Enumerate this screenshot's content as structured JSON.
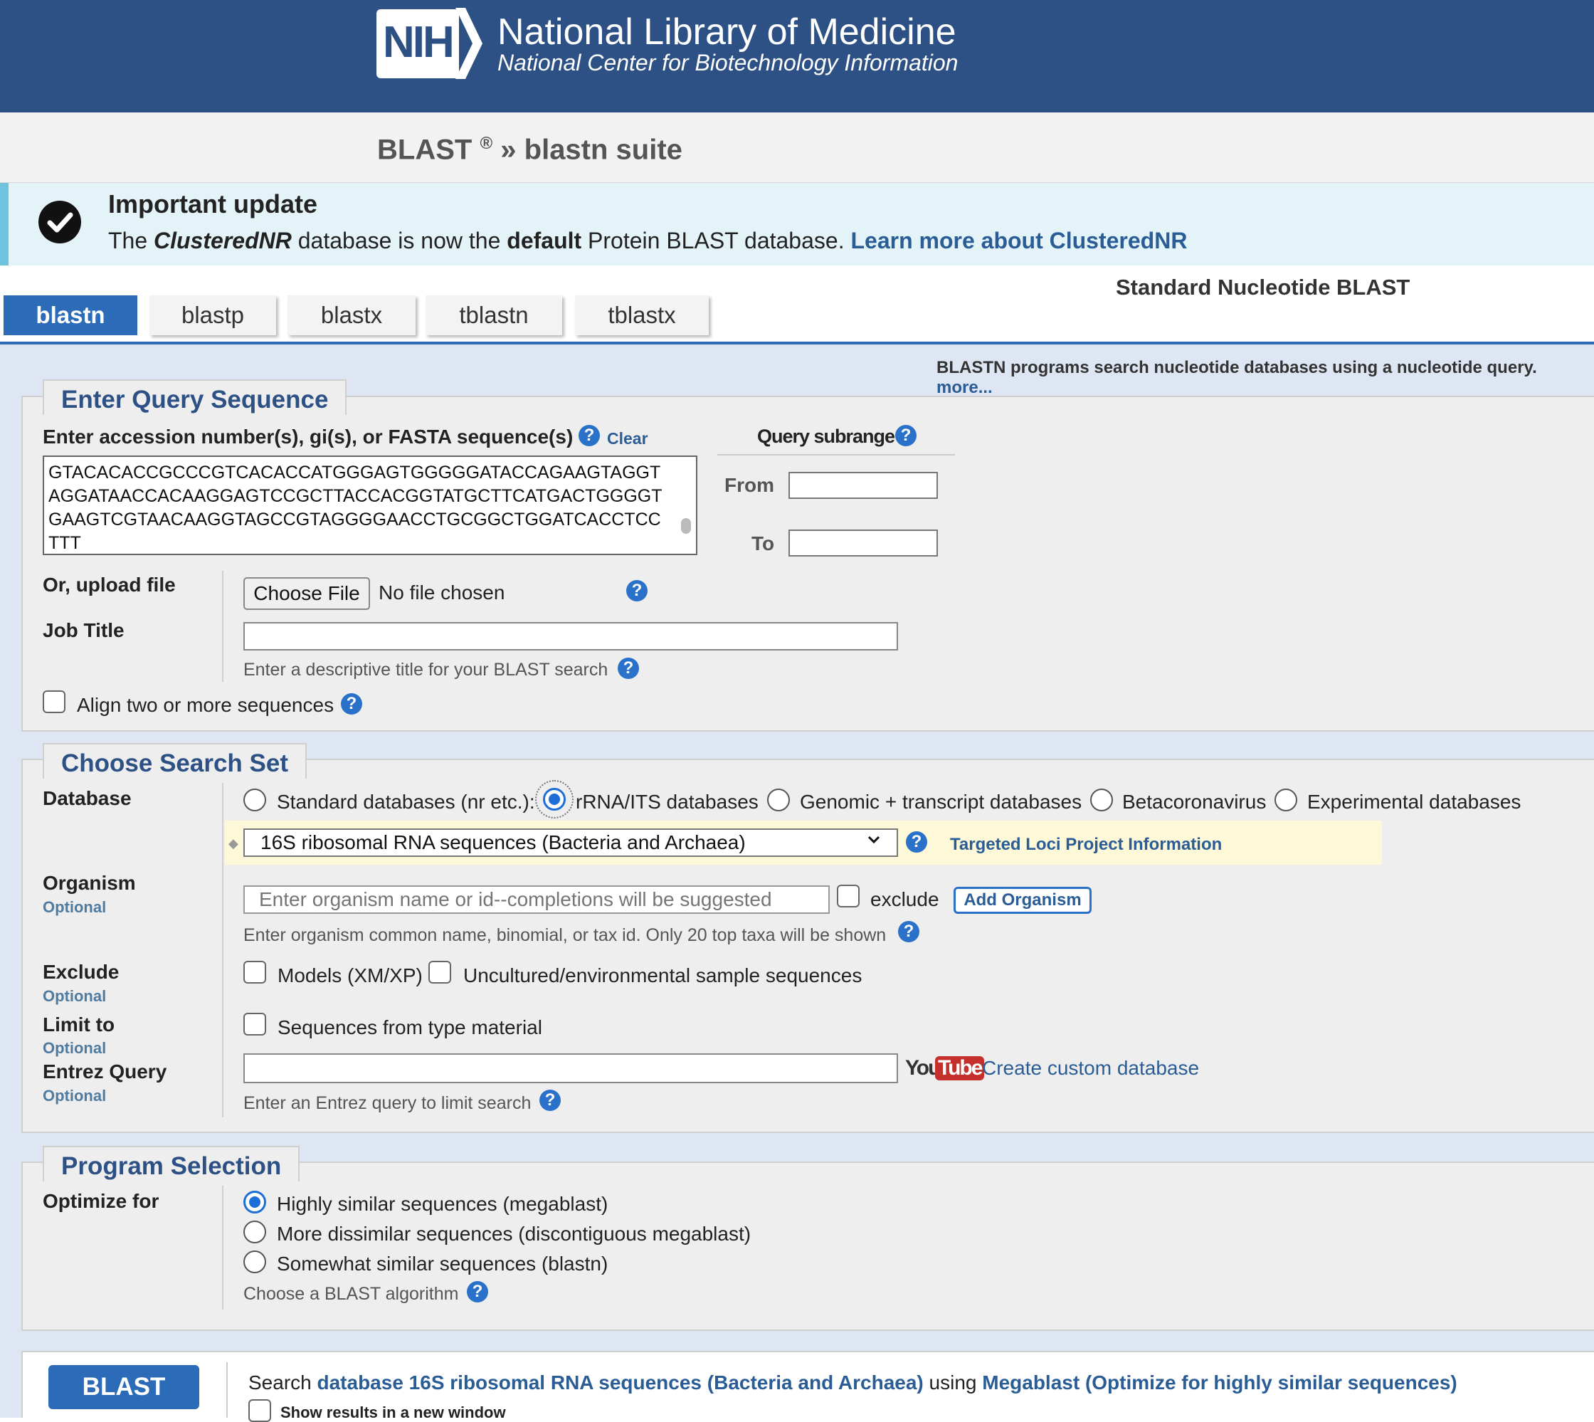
{
  "header": {
    "logo_text": "NIH",
    "title": "National Library of Medicine",
    "subtitle": "National Center for Biotechnology Information"
  },
  "breadcrumb": {
    "blast": "BLAST",
    "reg": "®",
    "sep": "»",
    "suite": "blastn suite"
  },
  "banner": {
    "title": "Important update",
    "text_1": "The ",
    "text_em": "ClusteredNR",
    "text_2": " database is now the ",
    "text_strong": "default",
    "text_3": " Protein BLAST database. ",
    "link": "Learn more about ClusteredNR"
  },
  "tabs": {
    "heading": "Standard Nucleotide BLAST",
    "items": [
      "blastn",
      "blastp",
      "blastx",
      "tblastn",
      "tblastx"
    ],
    "active": "blastn"
  },
  "program_desc": {
    "text": "BLASTN programs search nucleotide databases using a nucleotide query.",
    "more": "more..."
  },
  "query": {
    "legend": "Enter Query Sequence",
    "label": "Enter accession number(s), gi(s), or FASTA sequence(s)",
    "clear": "Clear",
    "sequence_lines": [
      "GTACACACCGCCCGTCACACCATGGGAGTGGGGGATACCAGAAGTAGGT",
      "AGGATAACCACAAGGAGTCCGCTTACCACGGTATGCTTCATGACTGGGGT",
      "GAAGTCGTAACAAGGTAGCCGTAGGGGAACCTGCGGCTGGATCACCTCC",
      "TTT"
    ],
    "subrange_label": "Query subrange",
    "from_label": "From",
    "to_label": "To",
    "from_value": "",
    "to_value": "",
    "upload_label": "Or, upload file",
    "choose_file": "Choose File",
    "no_file": "No file chosen",
    "job_title_label": "Job Title",
    "job_title_value": "",
    "job_title_hint": "Enter a descriptive title for your BLAST search",
    "align_label": "Align two or more sequences"
  },
  "search_set": {
    "legend": "Choose Search Set",
    "database_label": "Database",
    "db_options": [
      "Standard databases (nr etc.):",
      "rRNA/ITS databases",
      "Genomic + transcript databases",
      "Betacoronavirus",
      "Experimental databases"
    ],
    "db_selected": "rRNA/ITS databases",
    "db_select_value": "16S ribosomal RNA sequences (Bacteria and Archaea)",
    "targeted_loci_link": "Targeted Loci Project Information",
    "organism_label": "Organism",
    "optional": "Optional",
    "organism_placeholder": "Enter organism name or id--completions will be suggested",
    "exclude_cb_label": "exclude",
    "add_organism": "Add Organism",
    "organism_hint": "Enter organism common name, binomial, or tax id. Only 20 top taxa will be shown",
    "exclude_label": "Exclude",
    "models_label": "Models (XM/XP)",
    "uncultured_label": "Uncultured/environmental sample sequences",
    "limit_label": "Limit to",
    "type_material_label": "Sequences from type material",
    "entrez_label": "Entrez Query",
    "entrez_value": "",
    "youtube_you": "You",
    "youtube_tube": "Tube",
    "custom_db_link": "Create custom database",
    "entrez_hint": "Enter an Entrez query to limit search"
  },
  "program": {
    "legend": "Program Selection",
    "optimize_label": "Optimize for",
    "options": [
      "Highly similar sequences (megablast)",
      "More dissimilar sequences (discontiguous megablast)",
      "Somewhat similar sequences (blastn)"
    ],
    "selected": "Highly similar sequences (megablast)",
    "hint": "Choose a BLAST algorithm"
  },
  "submit": {
    "button": "BLAST",
    "search_word": "Search ",
    "db_link": "database 16S ribosomal RNA sequences (Bacteria and Archaea)",
    "using": " using ",
    "algo_link": "Megablast (Optimize for highly similar sequences)",
    "new_window": "Show results in a new window"
  }
}
